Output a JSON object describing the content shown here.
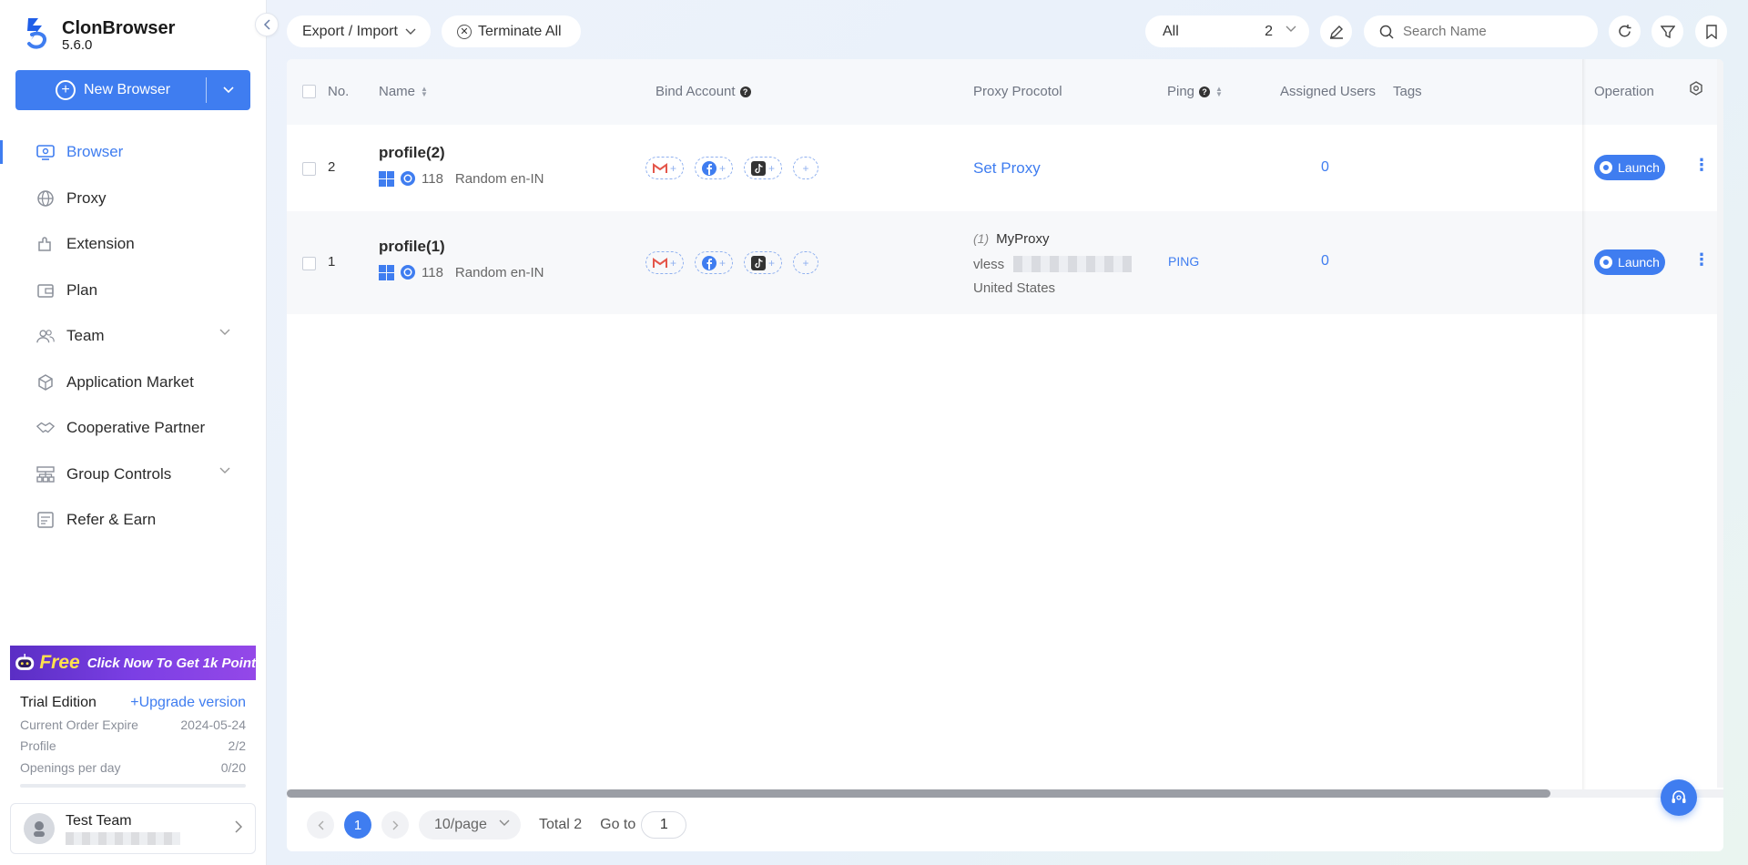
{
  "app": {
    "name": "ClonBrowser",
    "version": "5.6.0"
  },
  "sidebar": {
    "new_browser_label": "New Browser",
    "items": [
      {
        "label": "Browser",
        "icon": "browser-icon",
        "active": true,
        "expandable": false
      },
      {
        "label": "Proxy",
        "icon": "globe-icon",
        "active": false,
        "expandable": false
      },
      {
        "label": "Extension",
        "icon": "puzzle-icon",
        "active": false,
        "expandable": false
      },
      {
        "label": "Plan",
        "icon": "wallet-icon",
        "active": false,
        "expandable": false
      },
      {
        "label": "Team",
        "icon": "team-icon",
        "active": false,
        "expandable": true
      },
      {
        "label": "Application Market",
        "icon": "cube-icon",
        "active": false,
        "expandable": false
      },
      {
        "label": "Cooperative Partner",
        "icon": "handshake-icon",
        "active": false,
        "expandable": false
      },
      {
        "label": "Group Controls",
        "icon": "sitemap-icon",
        "active": false,
        "expandable": true
      },
      {
        "label": "Refer & Earn",
        "icon": "gift-card-icon",
        "active": false,
        "expandable": false
      }
    ],
    "promo": {
      "free": "Free",
      "text": "Click Now To Get 1k Point"
    },
    "plan": {
      "title": "Trial Edition",
      "upgrade": "+Upgrade version",
      "rows": [
        {
          "label": "Current Order Expire",
          "value": "2024-05-24"
        },
        {
          "label": "Profile",
          "value": "2/2"
        },
        {
          "label": "Openings per day",
          "value": "0/20"
        }
      ]
    },
    "team": {
      "name": "Test Team"
    }
  },
  "toolbar": {
    "export_import": "Export / Import",
    "terminate_all": "Terminate All",
    "filter_value": "All",
    "filter_count": "2",
    "search_placeholder": "Search Name"
  },
  "table": {
    "headers": {
      "no": "No.",
      "name": "Name",
      "bind_account": "Bind Account",
      "proxy_protocol": "Proxy Procotol",
      "ping": "Ping",
      "assigned_users": "Assigned Users",
      "tags": "Tags",
      "operation": "Operation"
    },
    "rows": [
      {
        "no": "2",
        "name": "profile(2)",
        "browser_version": "118",
        "locale": "Random en-IN",
        "proxy_action": "Set Proxy",
        "assigned_users": "0",
        "launch": "Launch"
      },
      {
        "no": "1",
        "name": "profile(1)",
        "browser_version": "118",
        "locale": "Random en-IN",
        "proxy_index": "(1)",
        "proxy_name": "MyProxy",
        "proxy_type": "vless",
        "proxy_country": "United States",
        "ping": "PING",
        "assigned_users": "0",
        "launch": "Launch"
      }
    ]
  },
  "pagination": {
    "current": "1",
    "page_size": "10/page",
    "total": "Total 2",
    "goto_label": "Go to",
    "goto_value": "1"
  },
  "colors": {
    "accent": "#3f7df0",
    "sidebar_bg": "#ffffff",
    "promo_start": "#5a2ec4"
  }
}
